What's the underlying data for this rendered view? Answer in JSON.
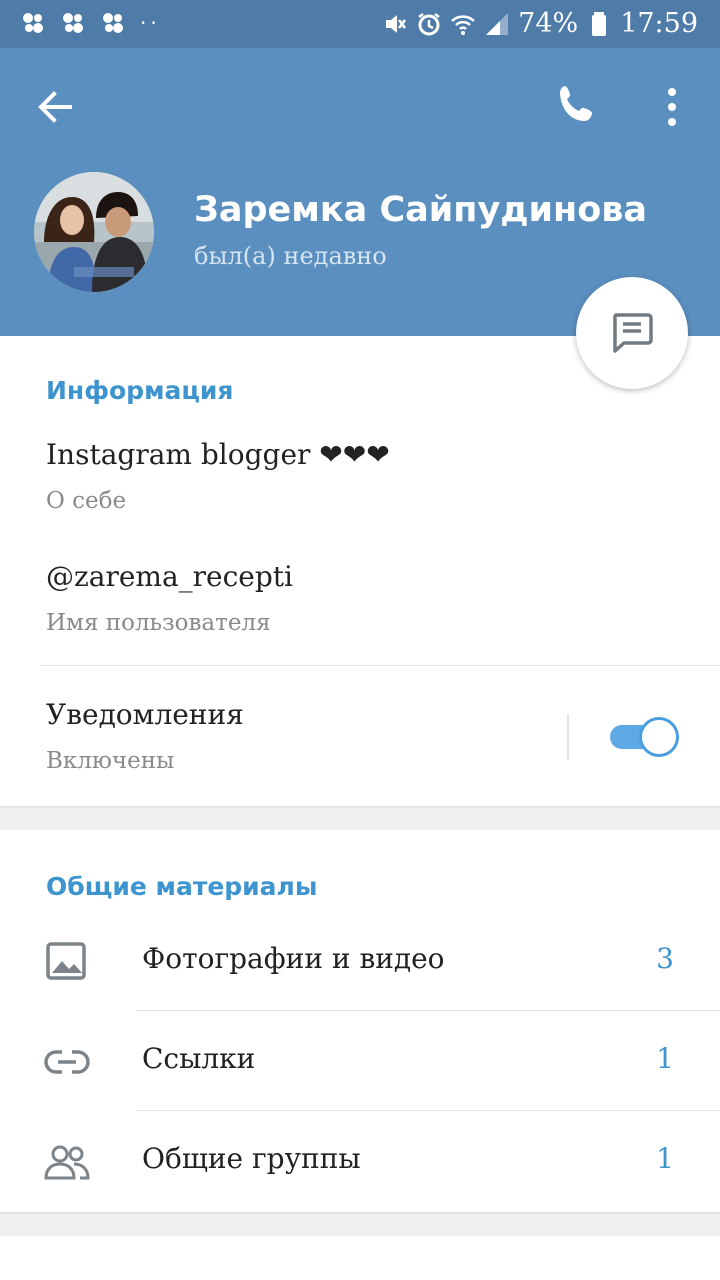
{
  "status_bar": {
    "battery": "74%",
    "time": "17:59",
    "bar_color": "#4f7ba8"
  },
  "header": {
    "back_icon": "arrow-left-icon",
    "call_icon": "phone-icon",
    "more_icon": "more-vert-icon",
    "bg_color": "#5b8fbf"
  },
  "profile": {
    "name": "Заремка Сайпудинова",
    "status": "был(а) недавно"
  },
  "fab": {
    "icon": "message-icon"
  },
  "info": {
    "title": "Информация",
    "bio": "Instagram blogger ❤❤❤",
    "bio_label": "О себе",
    "username": "@zarema_recepti",
    "username_label": "Имя пользователя",
    "notifications": "Уведомления",
    "notifications_state": "Включены",
    "notifications_on": true
  },
  "shared": {
    "title": "Общие материалы",
    "items": [
      {
        "label": "Фотографии и видео",
        "count": "3",
        "icon": "image-icon"
      },
      {
        "label": "Ссылки",
        "count": "1",
        "icon": "link-icon"
      },
      {
        "label": "Общие группы",
        "count": "1",
        "icon": "people-icon"
      }
    ]
  },
  "accent_color": "#3d94cf"
}
